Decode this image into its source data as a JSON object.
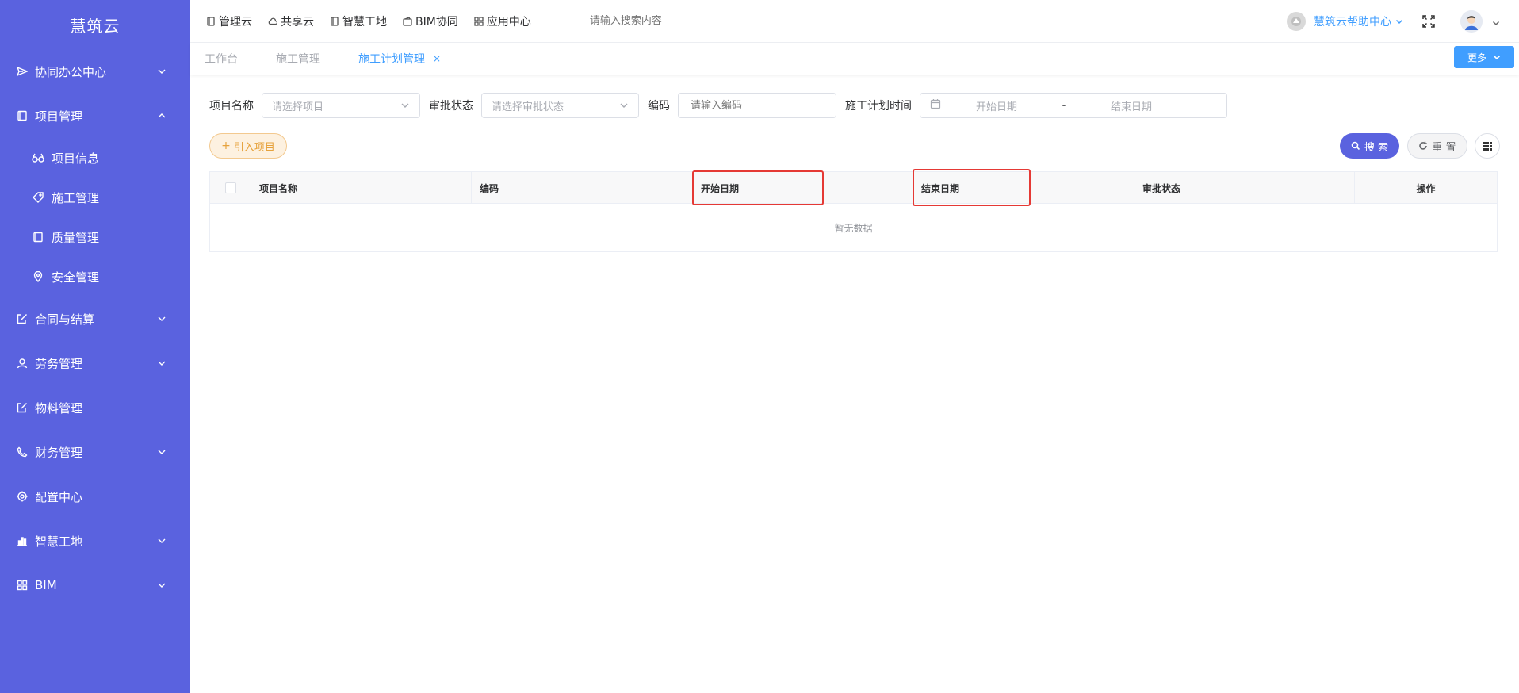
{
  "sidebar": {
    "brand": "慧筑云",
    "items": [
      {
        "label": "协同办公中心"
      },
      {
        "label": "项目管理"
      },
      {
        "label": "项目信息"
      },
      {
        "label": "施工管理"
      },
      {
        "label": "质量管理"
      },
      {
        "label": "安全管理"
      },
      {
        "label": "合同与结算"
      },
      {
        "label": "劳务管理"
      },
      {
        "label": "物料管理"
      },
      {
        "label": "财务管理"
      },
      {
        "label": "配置中心"
      },
      {
        "label": "智慧工地"
      },
      {
        "label": "BIM"
      }
    ]
  },
  "topnav": {
    "items": [
      "管理云",
      "共享云",
      "智慧工地",
      "BIM协同",
      "应用中心"
    ],
    "search_placeholder": "请输入搜索内容",
    "help": "慧筑云帮助中心"
  },
  "tabs": {
    "items": [
      "工作台",
      "施工管理",
      "施工计划管理"
    ],
    "close": "×",
    "more": "更多"
  },
  "filters": {
    "project_label": "项目名称",
    "project_placeholder": "请选择项目",
    "status_label": "审批状态",
    "status_placeholder": "请选择审批状态",
    "code_label": "编码",
    "code_placeholder": "请输入编码",
    "time_label": "施工计划时间",
    "start_placeholder": "开始日期",
    "separator": "-",
    "end_placeholder": "结束日期"
  },
  "actions": {
    "import": "引入项目",
    "search": "搜 索",
    "reset": "重 置"
  },
  "table": {
    "columns": [
      "项目名称",
      "编码",
      "开始日期",
      "结束日期",
      "审批状态",
      "操作"
    ],
    "empty": "暂无数据"
  },
  "colors": {
    "sidebar": "#5a62df",
    "accent": "#409eff",
    "primary_button": "#5a62df",
    "annotation": "#e53935"
  }
}
